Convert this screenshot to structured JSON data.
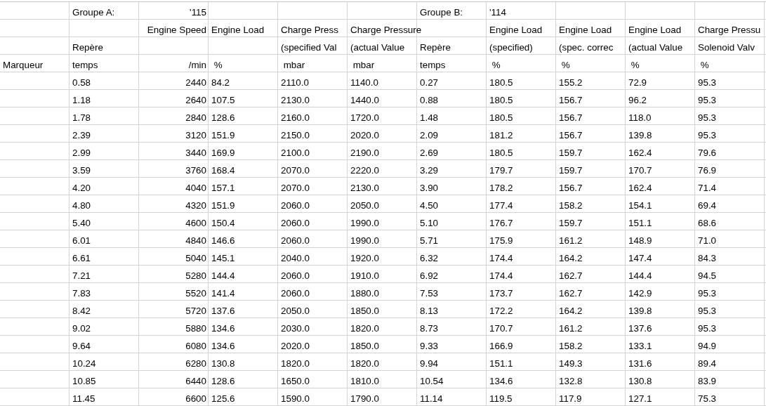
{
  "columns": [
    {
      "kind": "text"
    },
    {
      "kind": "text"
    },
    {
      "kind": "number"
    },
    {
      "kind": "text"
    },
    {
      "kind": "text"
    },
    {
      "kind": "text"
    },
    {
      "kind": "text"
    },
    {
      "kind": "text"
    },
    {
      "kind": "text"
    },
    {
      "kind": "text"
    },
    {
      "kind": "text"
    }
  ],
  "rows": [
    {
      "cells": [
        null,
        "Groupe A:",
        "'115",
        null,
        null,
        null,
        "Groupe B:",
        "'114",
        null,
        null,
        null
      ]
    },
    {
      "cells": [
        null,
        null,
        "Engine Speed",
        "Engine Load",
        "Charge Press",
        "Charge Pressure",
        null,
        "Engine Load",
        "Engine Load",
        "Engine Load",
        "Charge Pressu"
      ]
    },
    {
      "cells": [
        null,
        "Repère",
        null,
        null,
        "(specified Val",
        "(actual Value",
        "Repère",
        "(specified)",
        "(spec. correc",
        "(actual Value",
        "Solenoid Valv"
      ]
    },
    {
      "cells": [
        "Marqueur",
        "temps",
        " /min",
        " %",
        " mbar",
        " mbar",
        "temps",
        " %",
        " %",
        " %",
        " %"
      ]
    },
    {
      "cells": [
        null,
        "0.58",
        "2440",
        "84.2",
        "2110.0",
        "1140.0",
        "0.27",
        "180.5",
        "155.2",
        "72.9",
        "95.3"
      ]
    },
    {
      "cells": [
        null,
        "1.18",
        "2640",
        "107.5",
        "2130.0",
        "1440.0",
        "0.88",
        "180.5",
        "156.7",
        "96.2",
        "95.3"
      ]
    },
    {
      "cells": [
        null,
        "1.78",
        "2840",
        "128.6",
        "2160.0",
        "1720.0",
        "1.48",
        "180.5",
        "156.7",
        "118.0",
        "95.3"
      ]
    },
    {
      "cells": [
        null,
        "2.39",
        "3120",
        "151.9",
        "2150.0",
        "2020.0",
        "2.09",
        "181.2",
        "156.7",
        "139.8",
        "95.3"
      ]
    },
    {
      "cells": [
        null,
        "2.99",
        "3440",
        "169.9",
        "2100.0",
        "2190.0",
        "2.69",
        "180.5",
        "159.7",
        "162.4",
        "79.6"
      ]
    },
    {
      "cells": [
        null,
        "3.59",
        "3760",
        "168.4",
        "2070.0",
        "2220.0",
        "3.29",
        "179.7",
        "159.7",
        "170.7",
        "76.9"
      ]
    },
    {
      "cells": [
        null,
        "4.20",
        "4040",
        "157.1",
        "2070.0",
        "2130.0",
        "3.90",
        "178.2",
        "156.7",
        "162.4",
        "71.4"
      ]
    },
    {
      "cells": [
        null,
        "4.80",
        "4320",
        "151.9",
        "2060.0",
        "2050.0",
        "4.50",
        "177.4",
        "158.2",
        "154.1",
        "69.4"
      ]
    },
    {
      "cells": [
        null,
        "5.40",
        "4600",
        "150.4",
        "2060.0",
        "1990.0",
        "5.10",
        "176.7",
        "159.7",
        "151.1",
        "68.6"
      ]
    },
    {
      "cells": [
        null,
        "6.01",
        "4840",
        "146.6",
        "2060.0",
        "1990.0",
        "5.71",
        "175.9",
        "161.2",
        "148.9",
        "71.0"
      ]
    },
    {
      "cells": [
        null,
        "6.61",
        "5040",
        "145.1",
        "2040.0",
        "1920.0",
        "6.32",
        "174.4",
        "164.2",
        "147.4",
        "84.3"
      ]
    },
    {
      "cells": [
        null,
        "7.21",
        "5280",
        "144.4",
        "2060.0",
        "1910.0",
        "6.92",
        "174.4",
        "162.7",
        "144.4",
        "94.5"
      ]
    },
    {
      "cells": [
        null,
        "7.83",
        "5520",
        "141.4",
        "2060.0",
        "1880.0",
        "7.53",
        "173.7",
        "162.7",
        "142.9",
        "95.3"
      ]
    },
    {
      "cells": [
        null,
        "8.42",
        "5720",
        "137.6",
        "2050.0",
        "1850.0",
        "8.13",
        "172.2",
        "164.2",
        "139.8",
        "95.3"
      ]
    },
    {
      "cells": [
        null,
        "9.02",
        "5880",
        "134.6",
        "2030.0",
        "1820.0",
        "8.73",
        "170.7",
        "161.2",
        "137.6",
        "95.3"
      ]
    },
    {
      "cells": [
        null,
        "9.64",
        "6080",
        "134.6",
        "2020.0",
        "1850.0",
        "9.33",
        "166.9",
        "158.2",
        "133.1",
        "94.9"
      ]
    },
    {
      "cells": [
        null,
        "10.24",
        "6280",
        "130.8",
        "1820.0",
        "1820.0",
        "9.94",
        "151.1",
        "149.3",
        "131.6",
        "89.4"
      ]
    },
    {
      "cells": [
        null,
        "10.85",
        "6440",
        "128.6",
        "1650.0",
        "1810.0",
        "10.54",
        "134.6",
        "132.8",
        "130.8",
        "83.9"
      ]
    },
    {
      "cells": [
        null,
        "11.45",
        "6600",
        "125.6",
        "1590.0",
        "1790.0",
        "11.14",
        "119.5",
        "117.9",
        "127.1",
        "75.3"
      ]
    }
  ]
}
